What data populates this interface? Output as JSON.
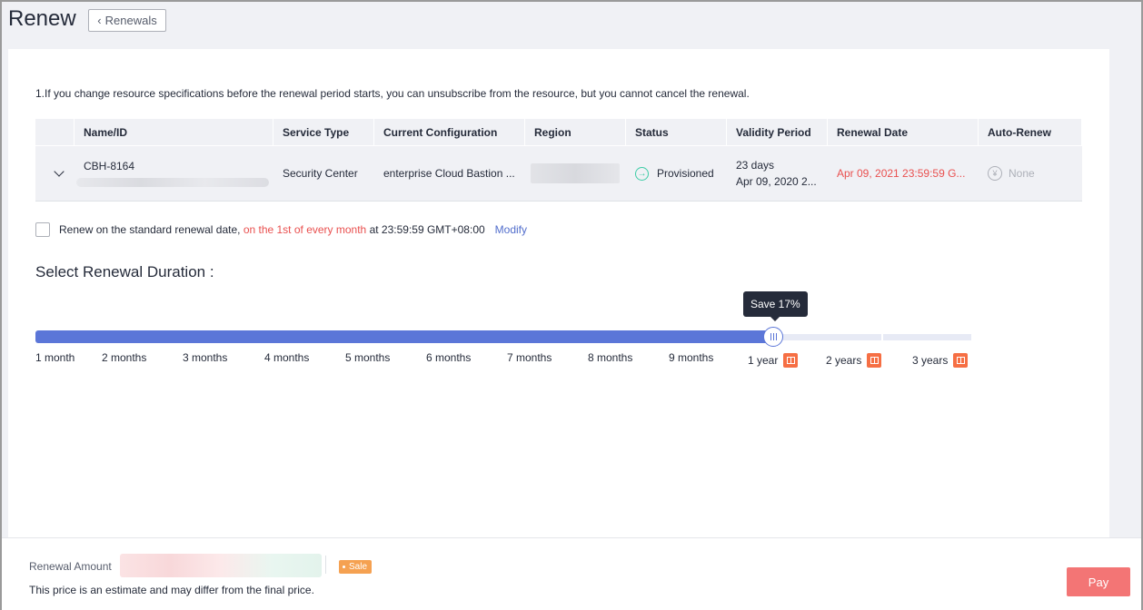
{
  "header": {
    "title": "Renew",
    "back_label": "Renewals"
  },
  "notice": "1.If you change resource specifications before the renewal period starts, you can unsubscribe from the resource, but you cannot cancel the renewal.",
  "table": {
    "columns": [
      "Name/ID",
      "Service Type",
      "Current Configuration",
      "Region",
      "Status",
      "Validity Period",
      "Renewal Date",
      "Auto-Renew"
    ],
    "row": {
      "name": "CBH-8164",
      "service_type": "Security Center",
      "configuration": "enterprise Cloud Bastion ...",
      "status": "Provisioned",
      "validity_days": "23 days",
      "validity_date": "Apr 09, 2020 2...",
      "renewal_date": "Apr 09, 2021 23:59:59 G...",
      "auto_renew": "None"
    }
  },
  "standard_renewal": {
    "prefix": "Renew on the standard renewal date,",
    "highlight": "on the 1st of every month",
    "suffix": "at 23:59:59 GMT+08:00",
    "modify_label": "Modify",
    "checked": false
  },
  "duration": {
    "title": "Select Renewal Duration :",
    "tooltip": "Save 17%",
    "selected": "1 year",
    "options": [
      "1 month",
      "2 months",
      "3 months",
      "4 months",
      "5 months",
      "6 months",
      "7 months",
      "8 months",
      "9 months",
      "1 year",
      "2 years",
      "3 years"
    ],
    "gift_options": [
      "1 year",
      "2 years",
      "3 years"
    ]
  },
  "footer": {
    "amount_label": "Renewal Amount",
    "sale_tag": "Sale",
    "estimate_note": "This price is an estimate and may differ from the final price.",
    "pay_label": "Pay"
  },
  "colors": {
    "accent": "#5b76d8",
    "danger": "#e9504f",
    "success": "#3dcca6",
    "pay": "#f26a6a",
    "gift": "#f66f44"
  },
  "icons": [
    "chevron-left-icon",
    "expand-chevron-icon",
    "provisioned-status-icon",
    "auto-renew-icon",
    "gift-icon"
  ]
}
